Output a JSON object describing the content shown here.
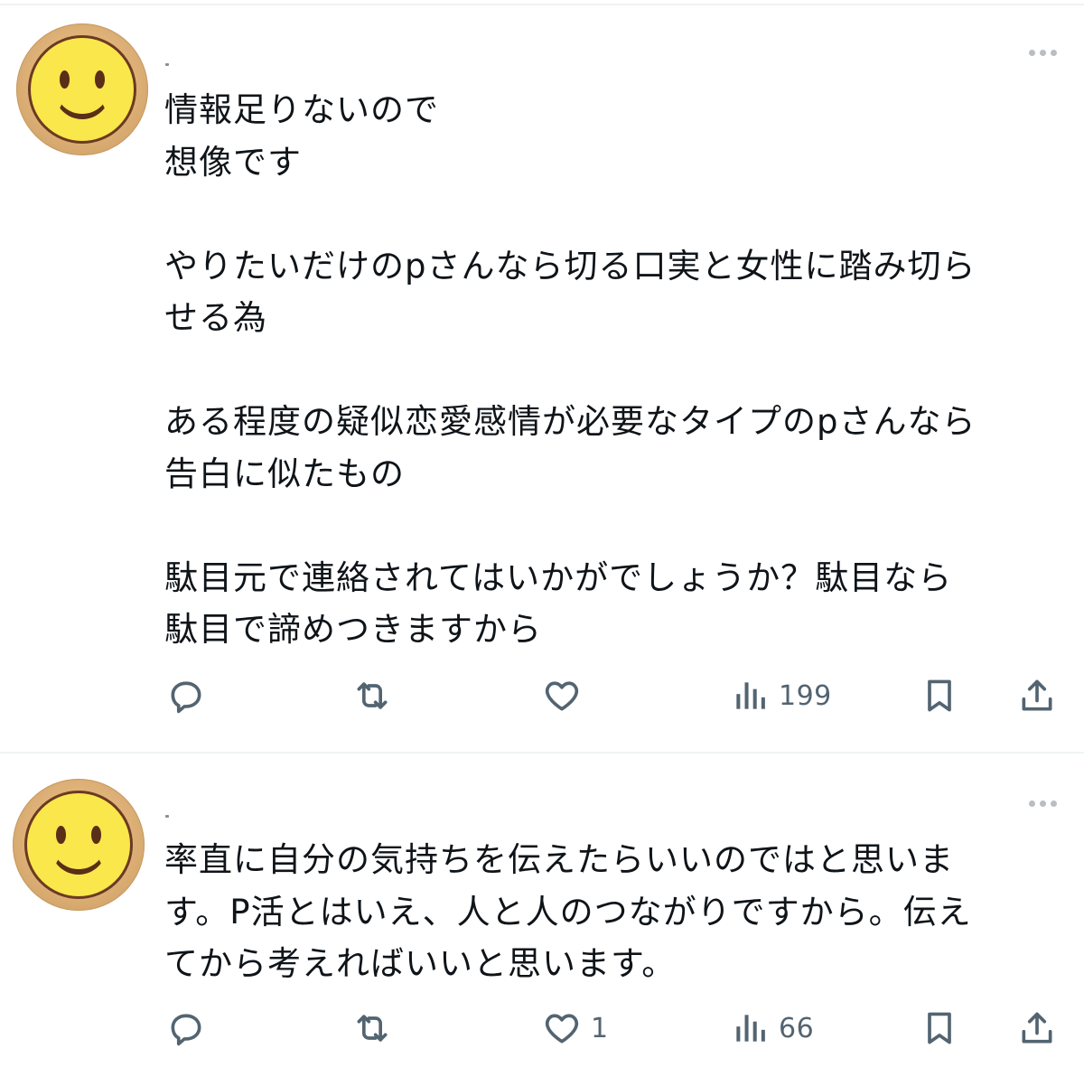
{
  "posts": [
    {
      "text": "情報足りないので\n想像です\n\nやりたいだけのpさんなら切る口実と女性に踏み切ら\nせる為\n\nある程度の疑似恋愛感情が必要なタイプのpさんなら\n告白に似たもの\n\n駄目元で連絡されてはいかがでしょうか？駄目なら\n駄目で諦めつきますから",
      "views": "199",
      "likes": ""
    },
    {
      "text": "率直に自分の気持ちを伝えたらいいのではと思いま\nす。P活とはいえ、人と人のつながりですから。伝え\nてから考えればいいと思います。",
      "views": "66",
      "likes": "1"
    }
  ],
  "colors": {
    "icon": "#536471",
    "divider": "#eff3f4",
    "text": "#0f1419"
  },
  "icons": [
    "reply-icon",
    "repost-icon",
    "like-icon",
    "views-icon",
    "bookmark-icon",
    "share-icon",
    "more-icon"
  ]
}
